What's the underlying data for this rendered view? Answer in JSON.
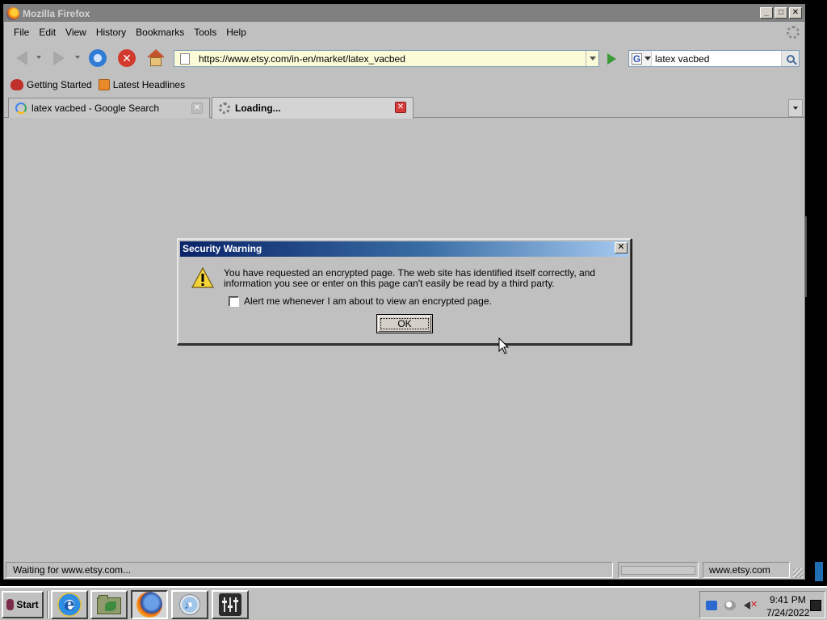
{
  "window": {
    "title": "Mozilla Firefox",
    "controls": {
      "minimize": "_",
      "maximize": "□",
      "close": "✕"
    }
  },
  "menubar": {
    "items": [
      "File",
      "Edit",
      "View",
      "History",
      "Bookmarks",
      "Tools",
      "Help"
    ]
  },
  "navbar": {
    "url": "https://www.etsy.com/in-en/market/latex_vacbed",
    "search_engine_letter": "G",
    "search_query": "latex vacbed",
    "stop_glyph": "✕"
  },
  "bookmarks": {
    "items": [
      "Getting Started",
      "Latest Headlines"
    ]
  },
  "tabs": [
    {
      "label": "latex vacbed - Google Search",
      "active": false,
      "close": "✕"
    },
    {
      "label": "Loading...",
      "active": true,
      "close": "✕"
    }
  ],
  "statusbar": {
    "status": "Waiting for www.etsy.com...",
    "domain": "www.etsy.com"
  },
  "dialog": {
    "title": "Security Warning",
    "close": "✕",
    "message": "You have requested an encrypted page. The web site has identified itself correctly, and information you see or enter on this page can't easily be read by a third party.",
    "checkbox_label": "Alert me whenever I am about to view an encrypted page.",
    "checkbox_checked": false,
    "ok_label": "OK"
  },
  "taskbar": {
    "start_label": "Start",
    "ie_glyph": "e",
    "media_glyph": "♪",
    "mute_glyph": "✕",
    "clock_time": "9:41 PM",
    "clock_date": "7/24/2022"
  }
}
